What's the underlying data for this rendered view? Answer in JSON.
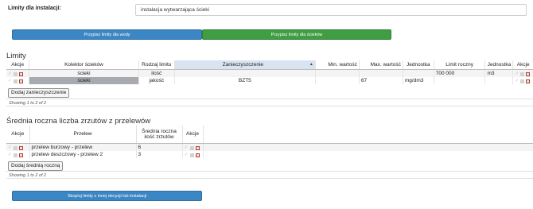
{
  "header": {
    "limits_label": "Limity dla instalacji:",
    "installation_value": "instalacja wytwarzająca ścieki"
  },
  "assign_buttons": {
    "water": "Przypisz limity dla wody",
    "sewage": "Przypisz limity dla ścieków"
  },
  "limits": {
    "title": "Limity",
    "columns": [
      "Akcje",
      "Kolektor ścieków",
      "Rodzaj limitu",
      "Zanieczyszczenie",
      "Min. wartość",
      "Max. wartość",
      "Jednostka",
      "Limit roczny",
      "Jednostka",
      "Akcje"
    ],
    "rows": [
      {
        "collector": "ścieki",
        "limit_type": "ilość",
        "pollutant": "",
        "min": "",
        "max": "",
        "unit": "",
        "annual_limit": "700 000",
        "annual_unit": "m3"
      },
      {
        "collector": "ścieki",
        "limit_type": "jakość",
        "pollutant": "BZT5",
        "min": "",
        "max": "67",
        "unit": "mg/dm3",
        "annual_limit": "",
        "annual_unit": ""
      }
    ],
    "add_button": "Dodaj zanieczyszczenie",
    "info": "Showing 1 to 2 of 2"
  },
  "overflows": {
    "title": "Średnia roczna liczba zrzutów z przelewów",
    "columns": [
      "Akcje",
      "Przelew",
      "Średnia roczna ilość zrzutów",
      "Akcje"
    ],
    "rows": [
      {
        "name": "przelew burzowy - przelew",
        "count": "6"
      },
      {
        "name": "przelew deszczowy - przelew 2",
        "count": "3"
      }
    ],
    "add_button": "Dodaj średnią roczną",
    "info": "Showing 1 to 2 of 2"
  },
  "copy_button": "Skopiuj limity z innej decyzji lub instalacji",
  "colors": {
    "primary_blue": "#3b86c4",
    "success_green": "#3f9e43",
    "sorted_header": "#d9e3f1",
    "delete_red": "#b33a2e"
  }
}
